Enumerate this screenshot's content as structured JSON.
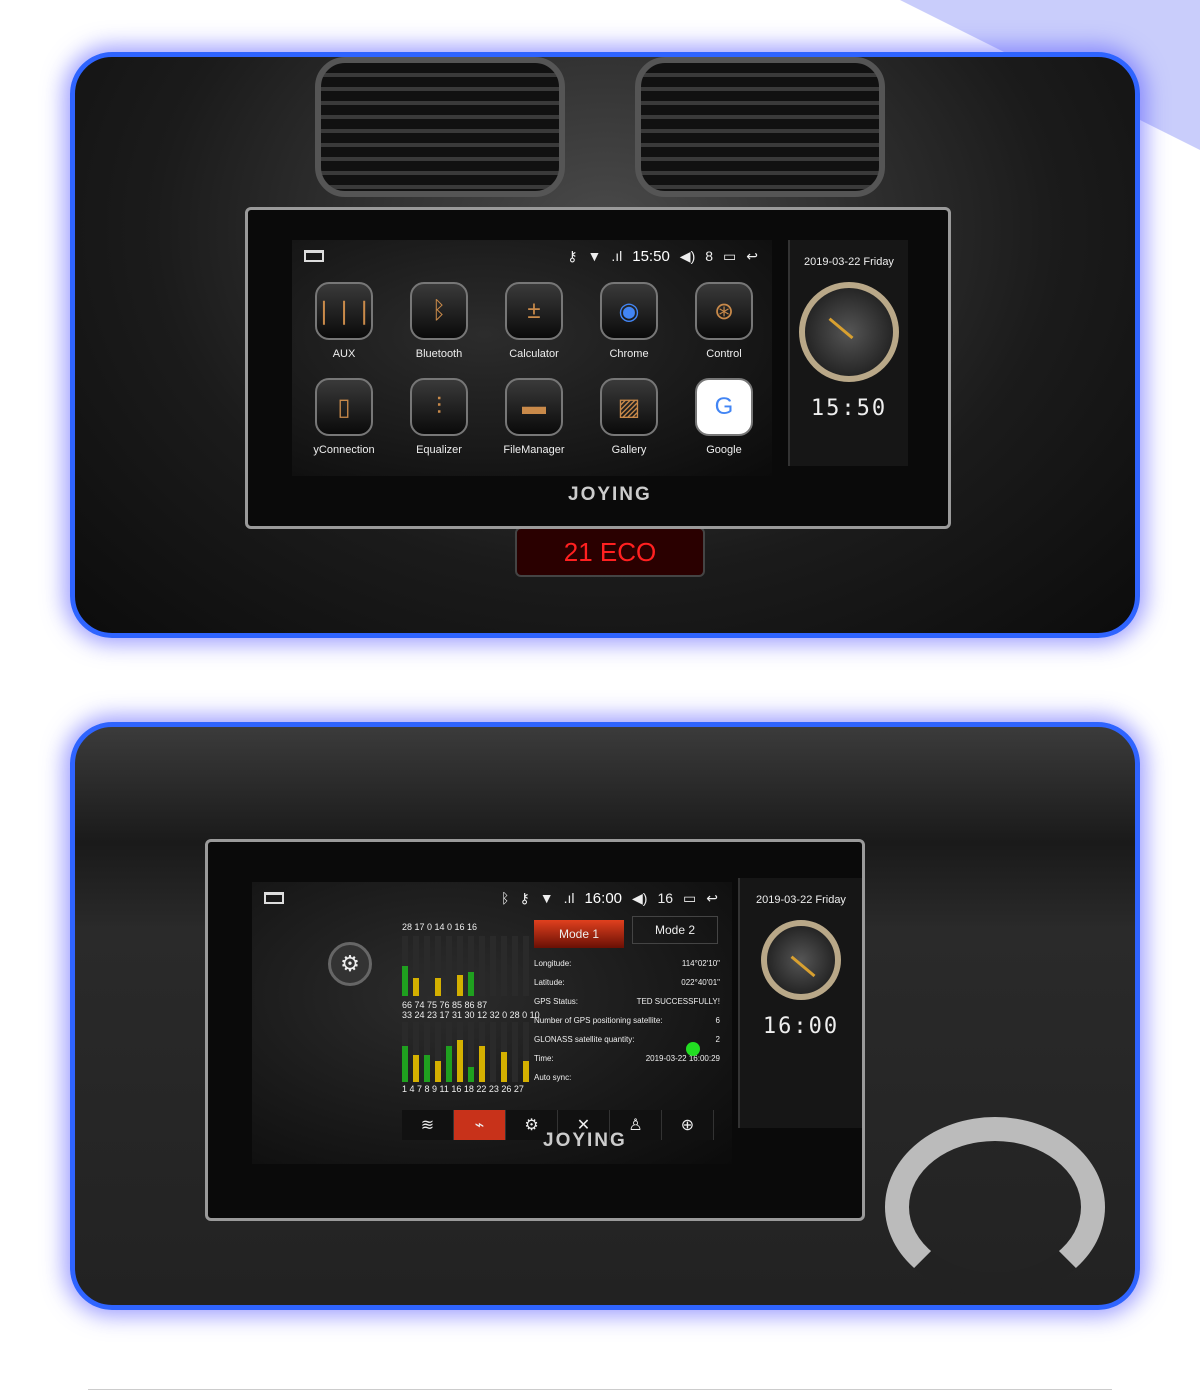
{
  "colors": {
    "frame": "#2f64ff",
    "accent_red": "#c8321a",
    "gps_green": "#1fa01f",
    "gps_yellow": "#d4b000",
    "toggle": "#22dd22"
  },
  "screen1": {
    "status": {
      "time": "15:50",
      "volume": "8",
      "icons": [
        "key-icon",
        "wifi-icon",
        "4g-signal-icon",
        "volume-icon",
        "recent-apps-icon",
        "back-icon"
      ]
    },
    "apps": [
      {
        "label": "AUX",
        "icon": "aux-cable-icon"
      },
      {
        "label": "Bluetooth",
        "icon": "bluetooth-icon"
      },
      {
        "label": "Calculator",
        "icon": "calculator-icon"
      },
      {
        "label": "Chrome",
        "icon": "chrome-icon"
      },
      {
        "label": "Control",
        "icon": "steering-wheel-icon"
      },
      {
        "label": "yConnection",
        "icon": "phone-link-icon"
      },
      {
        "label": "Equalizer",
        "icon": "equalizer-icon"
      },
      {
        "label": "FileManager",
        "icon": "folder-icon"
      },
      {
        "label": "Gallery",
        "icon": "gallery-icon"
      },
      {
        "label": "Google",
        "icon": "google-icon"
      }
    ],
    "side": {
      "date": "2019-03-22 Friday",
      "time": "15:50"
    },
    "brand": "JOYING",
    "dash_display": "21 ECO"
  },
  "screen2": {
    "status": {
      "time": "16:00",
      "volume": "16",
      "icons": [
        "bluetooth-icon",
        "key-icon",
        "wifi-icon",
        "4g-signal-icon",
        "volume-icon",
        "recent-apps-icon",
        "back-icon"
      ]
    },
    "modes": [
      "Mode 1",
      "Mode 2"
    ],
    "gps": [
      {
        "label": "Longitude:",
        "value": "114°02'10\""
      },
      {
        "label": "Latitude:",
        "value": "022°40'01\""
      },
      {
        "label": "GPS Status:",
        "value": "TED SUCCESSFULLY!"
      },
      {
        "label": "Number of GPS positioning satellite:",
        "value": "6"
      },
      {
        "label": "GLONASS satellite quantity:",
        "value": "2"
      },
      {
        "label": "Time:",
        "value": "2019-03-22 16:00:29"
      },
      {
        "label": "Auto sync:",
        "value": ""
      }
    ],
    "auto_sync_on": true,
    "sat_top_ids": "28 17 0 14 0 16 16",
    "sat_top_snr": "66 74 75 76 85 86 87",
    "sat_mid": "33 24 23 17 31 30 12 32 0 28 0 10",
    "sat_bottom_ids": "1 4 7 8 9 11 16 18 22 23 26 27",
    "top_levels": [
      0.5,
      0.3,
      0,
      0.3,
      0,
      0.35,
      0.4,
      0,
      0,
      0,
      0,
      0
    ],
    "bottom_levels": [
      0.6,
      0.45,
      0.45,
      0.35,
      0.6,
      0.7,
      0.25,
      0.6,
      0,
      0.5,
      0,
      0.35
    ],
    "tabs": [
      "wifi-icon",
      "gps-monitor-icon",
      "gear-icon",
      "tools-icon",
      "user-icon",
      "globe-icon"
    ],
    "side": {
      "date": "2019-03-22 Friday",
      "time": "16:00"
    },
    "brand": "JOYING"
  }
}
